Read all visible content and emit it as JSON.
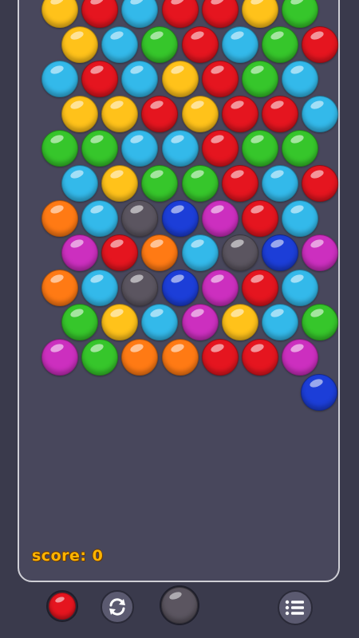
{
  "palette": {
    "yellow": "#ffc21a",
    "red": "#e5151f",
    "cyan": "#33b9ea",
    "green": "#36c62b",
    "orange": "#ff7a14",
    "gray": "#5b5560",
    "blue": "#1c3ed8",
    "magenta": "#cc2fbf"
  },
  "board": {
    "rows": [
      [
        "yellow",
        "red",
        "cyan",
        "red",
        "red",
        "yellow",
        "green"
      ],
      [
        "yellow",
        "cyan",
        "green",
        "red",
        "cyan",
        "green",
        "red"
      ],
      [
        "cyan",
        "red",
        "cyan",
        "yellow",
        "red",
        "green",
        "cyan"
      ],
      [
        "yellow",
        "yellow",
        "red",
        "yellow",
        "red",
        "red",
        "cyan"
      ],
      [
        "green",
        "green",
        "cyan",
        "cyan",
        "red",
        "green",
        "green"
      ],
      [
        "cyan",
        "yellow",
        "green",
        "green",
        "red",
        "cyan",
        "red"
      ],
      [
        "orange",
        "cyan",
        "gray",
        "blue",
        "magenta",
        "red",
        "cyan"
      ],
      [
        "magenta",
        "red",
        "orange",
        "cyan",
        "gray",
        "blue",
        "magenta"
      ],
      [
        "orange",
        "cyan",
        "gray",
        "blue",
        "magenta",
        "red",
        "cyan"
      ],
      [
        "green",
        "yellow",
        "cyan",
        "magenta",
        "yellow",
        "cyan",
        "green"
      ],
      [
        "magenta",
        "green",
        "orange",
        "orange",
        "red",
        "red",
        "magenta"
      ]
    ],
    "loose_bubble": "blue"
  },
  "score": {
    "text": "score: 0"
  },
  "controls": {
    "next_bubble": "red",
    "swap_icon": "swap-icon",
    "shooter_bubble": "gray",
    "menu_icon": "menu-list-icon"
  }
}
